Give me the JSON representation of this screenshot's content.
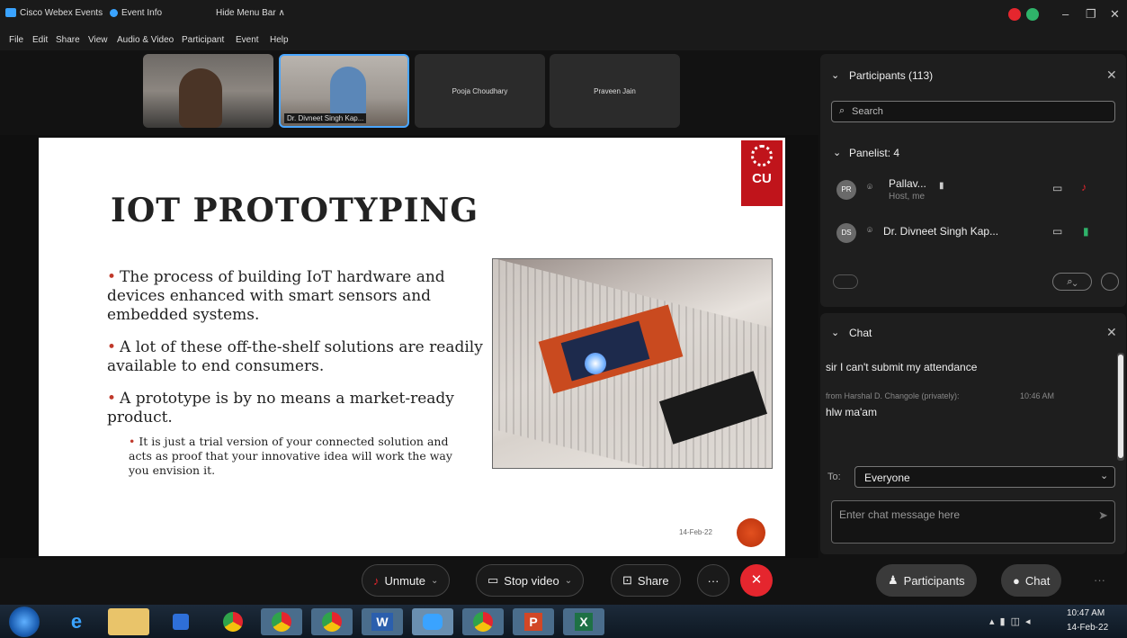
{
  "titlebar": {
    "app_name": "Cisco Webex Events",
    "event_info": "Event Info",
    "hide_menu": "Hide Menu Bar ∧",
    "minimize": "–",
    "restore": "❐",
    "close": "✕"
  },
  "menu": [
    "File",
    "Edit",
    "Share",
    "View",
    "Audio & Video",
    "Participant",
    "Event",
    "Help"
  ],
  "thumbnails": [
    {
      "name": ""
    },
    {
      "name": "Dr. Divneet Singh Kap..."
    },
    {
      "name": "Pooja Choudhary"
    },
    {
      "name": "Praveen Jain"
    }
  ],
  "slide": {
    "title": "IOT PROTOTYPING",
    "bullets": [
      "The process of building IoT hardware and devices enhanced with smart sensors and embedded systems.",
      "A lot of these off-the-shelf solutions are readily available to end consumers.",
      "A prototype is by no means a market-ready product."
    ],
    "sub_bullet": "It is just a trial version of your connected solution and acts as proof that your innovative idea will work the way you envision it.",
    "date": "14-Feb-22",
    "logo_text": "CU"
  },
  "participants": {
    "header": "Participants (113)",
    "search_placeholder": "Search",
    "panelist_header": "Panelist: 4",
    "list": [
      {
        "initials": "PR",
        "name": "Pallav...",
        "role": "Host, me"
      },
      {
        "initials": "DS",
        "name": "Dr. Divneet Singh Kap...",
        "role": ""
      }
    ]
  },
  "chat": {
    "header": "Chat",
    "messages": [
      {
        "from": "",
        "text": "sir I can't submit my attendance"
      },
      {
        "from": "from Harshal D. Changole (privately):",
        "time": "10:46 AM",
        "text": "hlw ma'am"
      }
    ],
    "to_label": "To:",
    "to_value": "Everyone",
    "input_placeholder": "Enter chat message here"
  },
  "controls": {
    "unmute": "Unmute",
    "stop_video": "Stop video",
    "share": "Share",
    "more": "···",
    "participants": "Participants",
    "chat": "Chat"
  },
  "taskbar": {
    "time": "10:47 AM",
    "date": "14-Feb-22"
  },
  "colors": {
    "end_call": "#e5262e",
    "accent": "#49a6ff"
  }
}
